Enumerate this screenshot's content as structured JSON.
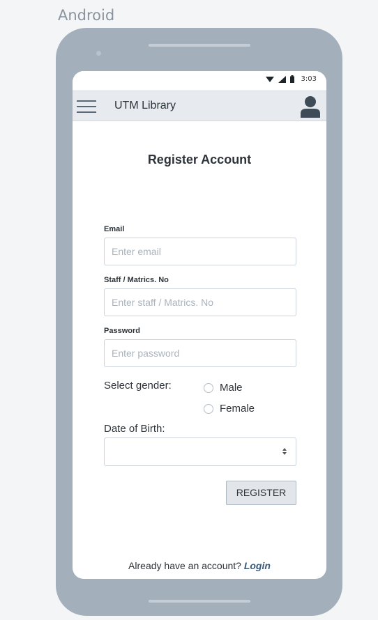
{
  "platform": "Android",
  "status_bar": {
    "time": "3:03",
    "icons": [
      "wifi-icon",
      "signal-icon",
      "battery-icon"
    ]
  },
  "app_bar": {
    "title": "UTM Library",
    "menu_icon": "hamburger-menu-icon",
    "profile_icon": "user-profile-icon"
  },
  "form": {
    "heading": "Register Account",
    "email": {
      "label": "Email",
      "placeholder": "Enter email",
      "value": ""
    },
    "staff_no": {
      "label": "Staff / Matrics. No",
      "placeholder": "Enter staff / Matrics. No",
      "value": ""
    },
    "password": {
      "label": "Password",
      "placeholder": "Enter password",
      "value": ""
    },
    "gender": {
      "label": "Select gender:",
      "options": [
        "Male",
        "Female"
      ],
      "selected": null
    },
    "dob": {
      "label": "Date of Birth:",
      "value": ""
    },
    "register_label": "REGISTER"
  },
  "footer": {
    "prompt": "Already have an account?",
    "login_label": "Login"
  },
  "colors": {
    "device_frame": "#a3afbb",
    "app_bar": "#e7ebf0",
    "link": "#3c5a7a",
    "button_bg": "#e2e6eb"
  }
}
